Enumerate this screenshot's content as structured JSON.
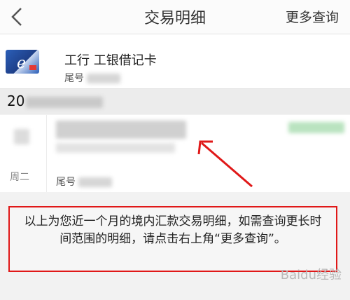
{
  "navbar": {
    "title": "交易明细",
    "more_label": "更多查询"
  },
  "card": {
    "bank_name": "工行 工银借记卡",
    "tail_prefix": "尾号"
  },
  "date_group": {
    "visible_text": "20"
  },
  "record": {
    "weekday": "周二",
    "tail_prefix": "尾号"
  },
  "notice": {
    "text": "以上为您近一个月的境内汇款交易明细，如需查询更长时间范围的明细，请点击右上角“更多查询”。"
  },
  "watermark": {
    "text": "Baidu经验"
  },
  "colors": {
    "highlight": "#e01818",
    "accent_green": "#4caf50"
  }
}
